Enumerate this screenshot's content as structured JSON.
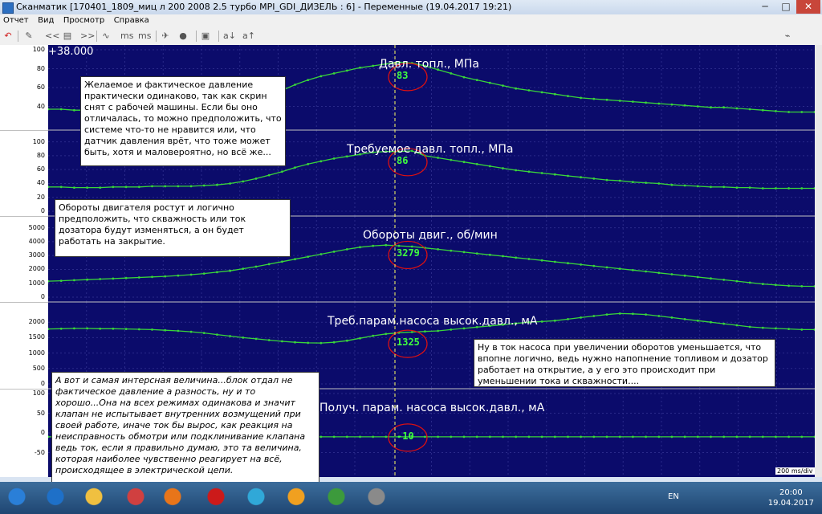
{
  "window": {
    "title": "Сканматик [170401_1809_миц л 200 2008 2.5 турбо MPI_GDI_ДИЗЕЛЬ : 6] - Переменные (19.04.2017 19:21)",
    "minimize": "─",
    "maximize": "□",
    "close": "✕"
  },
  "menu": [
    "Отчет",
    "Вид",
    "Просмотр",
    "Справка"
  ],
  "toolbar": {
    "buttons": [
      {
        "name": "back-arrow-icon",
        "glyph": "↶"
      },
      {
        "name": "edit-icon",
        "glyph": "✎"
      },
      {
        "name": "rewind-icon",
        "glyph": "<<"
      },
      {
        "name": "list-icon",
        "glyph": "▤"
      },
      {
        "name": "forward-icon",
        "glyph": ">>"
      },
      {
        "name": "wave-icon",
        "glyph": "∿"
      },
      {
        "name": "ms-minus-icon",
        "glyph": "ms"
      },
      {
        "name": "ms-plus-icon",
        "glyph": "ms"
      },
      {
        "name": "marker-icon",
        "glyph": "✈"
      },
      {
        "name": "record-icon",
        "glyph": "●"
      },
      {
        "name": "image-icon",
        "glyph": "▣"
      },
      {
        "name": "font-small-icon",
        "glyph": "a↓"
      },
      {
        "name": "font-large-icon",
        "glyph": "a↑"
      }
    ],
    "usb_glyph": "⌁"
  },
  "top_value": "+38.000",
  "scale_label": "200 ms/div",
  "panels": [
    {
      "title": "Давл. топл., МПа",
      "ticks": [
        "100",
        "80",
        "60",
        "40"
      ],
      "cursor_value": "83",
      "ymin": 20,
      "ymax": 100,
      "values": [
        37,
        37,
        36,
        36,
        36,
        37,
        37,
        38,
        38,
        38,
        38,
        39,
        40,
        40,
        42,
        44,
        47,
        52,
        57,
        63,
        68,
        72,
        75,
        78,
        81,
        83,
        85,
        87,
        86,
        83,
        79,
        75,
        71,
        68,
        65,
        62,
        59,
        57,
        55,
        53,
        51,
        49,
        48,
        47,
        46,
        45,
        44,
        43,
        42,
        41,
        40,
        39,
        39,
        38,
        37,
        36,
        35,
        34,
        34,
        34
      ]
    },
    {
      "title": "Требуемое давл. топл., МПа",
      "ticks": [
        "100",
        "80",
        "60",
        "40",
        "20",
        "0"
      ],
      "cursor_value": "86",
      "ymin": 0,
      "ymax": 110,
      "values": [
        35,
        35,
        34,
        34,
        34,
        35,
        35,
        35,
        36,
        36,
        36,
        36,
        37,
        38,
        40,
        43,
        47,
        52,
        57,
        63,
        68,
        72,
        76,
        79,
        82,
        85,
        86,
        86,
        87,
        80,
        77,
        74,
        71,
        68,
        65,
        62,
        59,
        57,
        55,
        53,
        51,
        49,
        47,
        45,
        44,
        42,
        41,
        40,
        38,
        37,
        36,
        35,
        35,
        34,
        34,
        33,
        33,
        33,
        33,
        33
      ]
    },
    {
      "title": "Обороты двиг., об/мин",
      "ticks": [
        "5000",
        "4000",
        "3000",
        "2000",
        "1000",
        "0"
      ],
      "cursor_value": "3279",
      "ymin": 0,
      "ymax": 5500,
      "values": [
        1150,
        1180,
        1220,
        1260,
        1300,
        1340,
        1380,
        1420,
        1460,
        1500,
        1560,
        1620,
        1700,
        1800,
        1900,
        2050,
        2200,
        2380,
        2560,
        2740,
        2920,
        3100,
        3279,
        3450,
        3600,
        3700,
        3750,
        3700,
        3650,
        3550,
        3450,
        3350,
        3250,
        3150,
        3050,
        2950,
        2850,
        2750,
        2650,
        2550,
        2450,
        2350,
        2250,
        2150,
        2050,
        1950,
        1850,
        1750,
        1650,
        1550,
        1450,
        1350,
        1250,
        1150,
        1050,
        950,
        880,
        820,
        790,
        780
      ]
    },
    {
      "title": "Треб.парам.насоса высок.давл., мА",
      "ticks": [
        "2000",
        "1500",
        "1000",
        "500",
        "0"
      ],
      "cursor_value": "1325",
      "ymin": 0,
      "ymax": 2500,
      "values": [
        1780,
        1790,
        1800,
        1800,
        1790,
        1790,
        1780,
        1770,
        1760,
        1740,
        1720,
        1690,
        1650,
        1600,
        1550,
        1500,
        1460,
        1420,
        1380,
        1350,
        1330,
        1325,
        1350,
        1400,
        1480,
        1560,
        1620,
        1660,
        1680,
        1700,
        1720,
        1760,
        1800,
        1840,
        1880,
        1920,
        1960,
        2000,
        2020,
        2050,
        2100,
        2150,
        2200,
        2250,
        2280,
        2270,
        2250,
        2200,
        2150,
        2100,
        2050,
        2000,
        1950,
        1900,
        1850,
        1820,
        1800,
        1780,
        1760,
        1760
      ]
    },
    {
      "title": "Получ. парам. насоса высок.давл., мА",
      "ticks": [
        "100",
        "50",
        "0",
        "-50"
      ],
      "cursor_value": "-10",
      "ymin": -100,
      "ymax": 100,
      "values": [
        -10,
        -10,
        -10,
        -10,
        -10,
        -10,
        -10,
        -10,
        -10,
        -10,
        -10,
        -10,
        -10,
        -10,
        -10,
        -10,
        -10,
        -10,
        -10,
        -10,
        -10,
        -10,
        -10,
        -10,
        -10,
        -10,
        -10,
        -10,
        -10,
        -10,
        -10,
        -10,
        -10,
        -10,
        -10,
        -10,
        -10,
        -10,
        -10,
        -10,
        -10,
        -10,
        -10,
        -10,
        -10,
        -10,
        -10,
        -10,
        -10,
        -10,
        -10,
        -10,
        -10,
        -10,
        -10,
        -10,
        -10,
        -10,
        -10,
        -10
      ]
    }
  ],
  "notes": [
    "Желаемое и фактическое давление практически одинаково, так как скрин снят с рабочей машины. Если бы оно отличалась, то можно предположить, что системе что-то не нравится или, что датчик давления врёт, что тоже может быть, хотя и маловероятно, но всё же...",
    "Обороты двигателя ростут и логично предположить, что скважность или ток дозатора будут изменяться, а он будет работать на закрытие.",
    "Ну в ток насоса при увеличении оборотов уменьшается, что впопне логично, ведь нужно напопнение топливом и дозатор работает на открытие, а у его это происходит при уменьшении тока и скважности....",
    "А вот и самая интерсная величина...блок отдал не фактическое давление а разность, ну и то хорошо...Она на всех режимах одинакова и значит клапан не испытывает внутренних возмущений при своей работе, иначе ток бы вырос, как реакция на неисправность обмотри или подклинивание клапана ведь ток, если я правильно думаю, это та величина, которая наиболее чувственно реагирует на всё, происходящее в электрической цепи."
  ],
  "colors": {
    "background": "#0b0b6b",
    "trace": "#39d53a",
    "cursor": "#ffff66",
    "circle": "#e01010"
  },
  "taskbar": {
    "icons": [
      "start-orb-icon",
      "ie-icon",
      "explorer-icon",
      "media-player-icon",
      "firefox-icon",
      "opera-icon",
      "mail-icon",
      "search-app-icon",
      "chrome-icon",
      "scanmatik-icon"
    ],
    "lang": "EN",
    "time": "20:00",
    "date": "19.04.2017"
  }
}
